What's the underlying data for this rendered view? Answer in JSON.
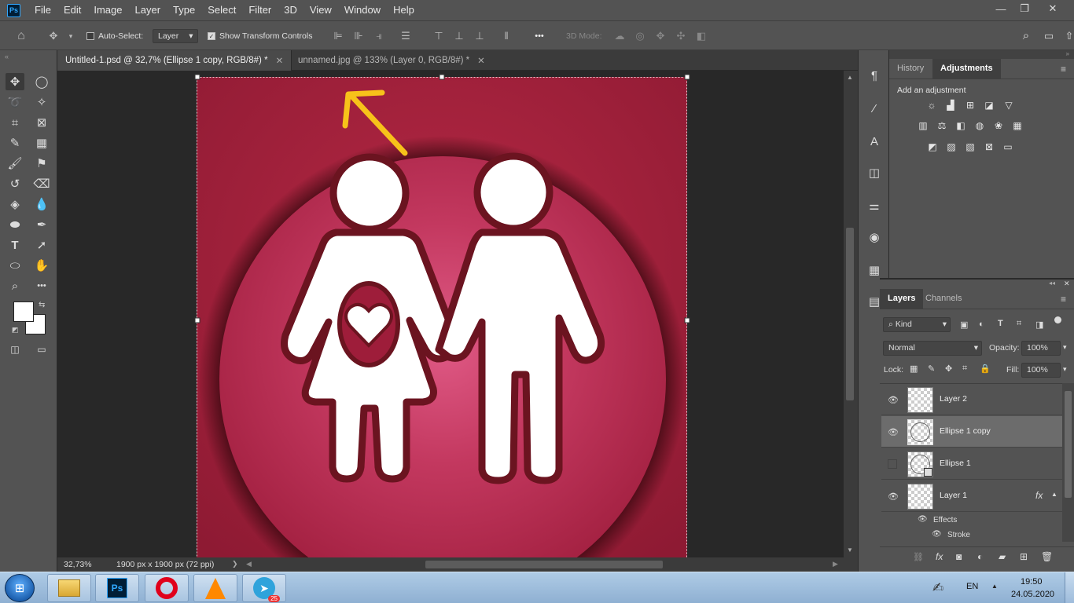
{
  "app": {
    "logo": "Ps"
  },
  "menu": [
    "File",
    "Edit",
    "Image",
    "Layer",
    "Type",
    "Select",
    "Filter",
    "3D",
    "View",
    "Window",
    "Help"
  ],
  "window_controls": {
    "minimize": "—",
    "restore": "❐",
    "close": "✕"
  },
  "options": {
    "auto_select_label": "Auto-Select:",
    "auto_select_target": "Layer",
    "show_transform_label": "Show Transform Controls",
    "mode_3d_label": "3D Mode:",
    "more": "•••"
  },
  "tabs": [
    {
      "label": "Untitled-1.psd @ 32,7% (Ellipse 1 copy, RGB/8#) *",
      "close": "✕"
    },
    {
      "label": "unnamed.jpg @ 133% (Layer 0, RGB/8#) *",
      "close": "✕"
    }
  ],
  "status": {
    "zoom": "32,73%",
    "doc_info": "1900 px x 1900 px (72 ppi)",
    "arrow": "❯"
  },
  "adjustments": {
    "tabs": [
      "History",
      "Adjustments"
    ],
    "active_tab": "Adjustments",
    "subtitle": "Add an adjustment"
  },
  "layers": {
    "tabs": [
      "Layers",
      "Channels"
    ],
    "active_tab": "Layers",
    "filter_kind": "Kind",
    "blend_mode": "Normal",
    "opacity_label": "Opacity:",
    "opacity": "100%",
    "lock_label": "Lock:",
    "fill_label": "Fill:",
    "fill": "100%",
    "items": [
      {
        "name": "Layer 2",
        "visible": true,
        "selected": false
      },
      {
        "name": "Ellipse 1 copy",
        "visible": true,
        "selected": true
      },
      {
        "name": "Ellipse 1",
        "visible": false,
        "selected": false
      },
      {
        "name": "Layer 1",
        "visible": true,
        "selected": false,
        "fx": "fx"
      }
    ],
    "effects_label": "Effects",
    "stroke_label": "Stroke"
  },
  "taskbar": {
    "language": "EN",
    "time": "19:50",
    "date": "24.05.2020",
    "telegram_badge": "25"
  },
  "colors": {
    "panel": "#535353",
    "canvas_bg": "#282828",
    "artwork_red": "#9e1d3a",
    "highlight_pink": "#d44a78",
    "outline_dark": "#6b1420",
    "arrow_yellow": "#f7c21a"
  }
}
